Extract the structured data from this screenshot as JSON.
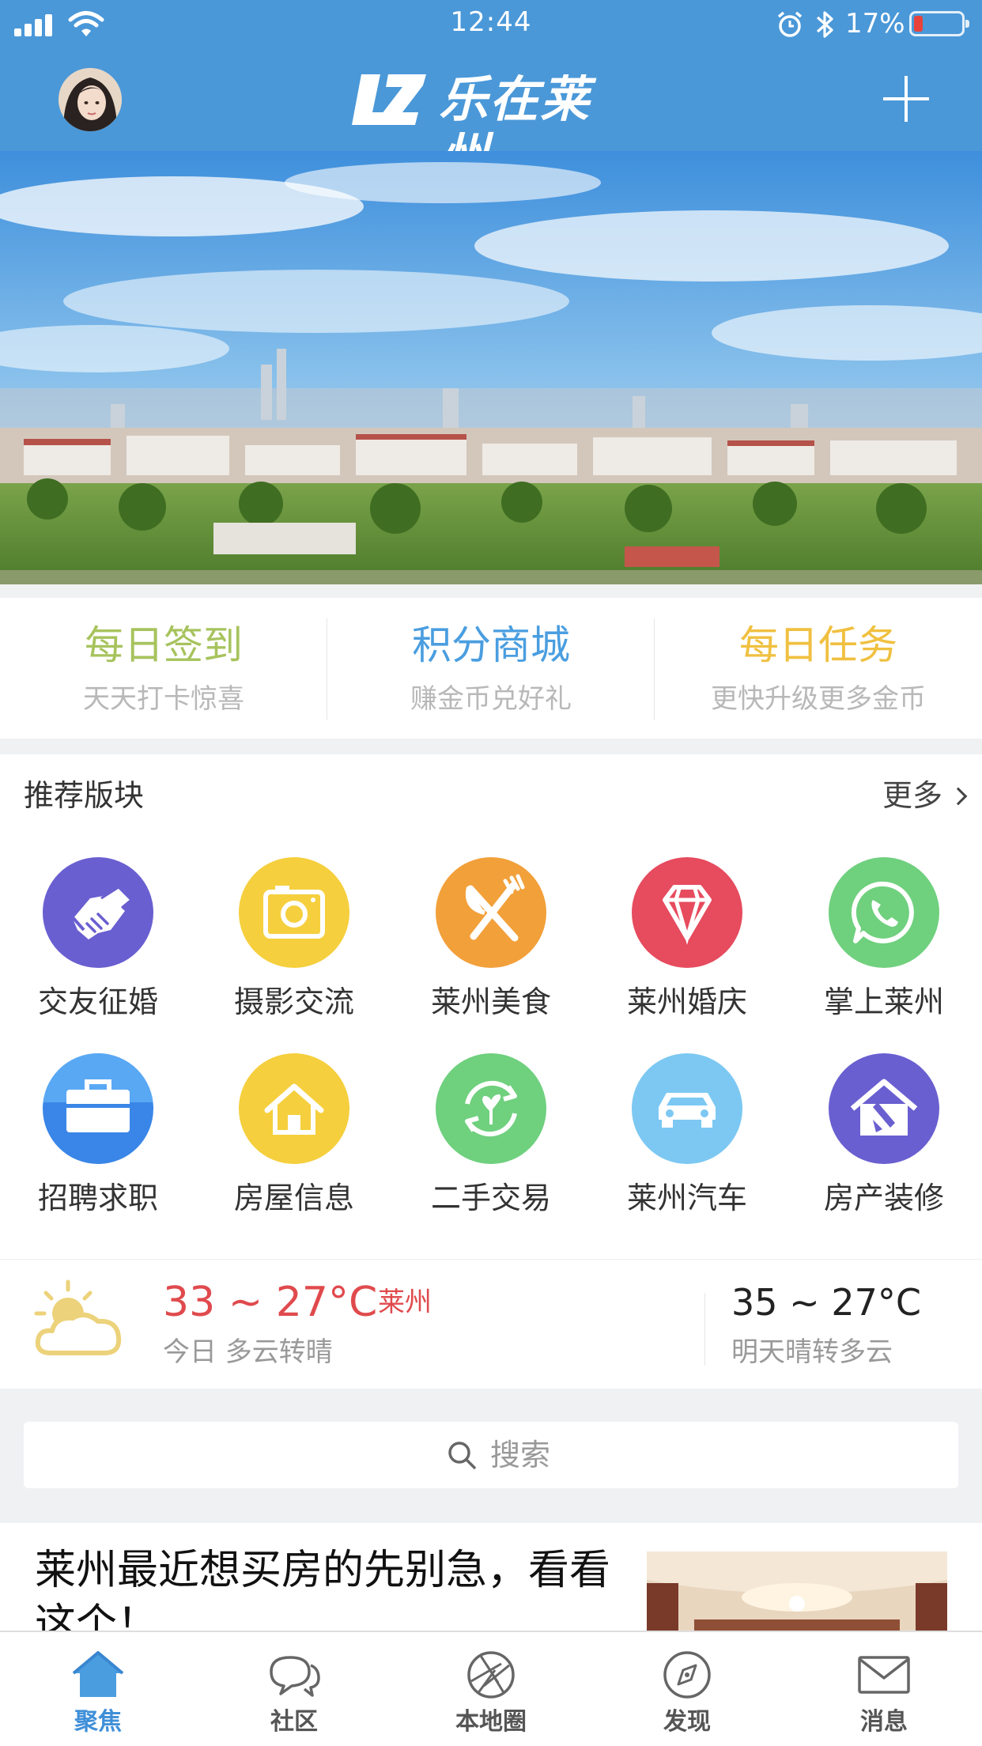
{
  "status_bar": {
    "time": "12:44",
    "battery": "17%"
  },
  "header": {
    "app_name": "乐在莱州",
    "logo_mark": "LZ",
    "add_icon": "plus-icon"
  },
  "quick_actions": [
    {
      "title": "每日签到",
      "subtitle": "天天打卡惊喜",
      "color": "#a7c35d"
    },
    {
      "title": "积分商城",
      "subtitle": "赚金币兑好礼",
      "color": "#4a9ee0"
    },
    {
      "title": "每日任务",
      "subtitle": "更快升级更多金币",
      "color": "#f0c040"
    }
  ],
  "recommended": {
    "title": "推荐版块",
    "more": "更多",
    "items": [
      {
        "label": "交友征婚",
        "icon": "handshake-icon",
        "color": "#6a5fd0"
      },
      {
        "label": "摄影交流",
        "icon": "camera-icon",
        "color": "#f5cf3d"
      },
      {
        "label": "莱州美食",
        "icon": "utensils-icon",
        "color": "#f2a03a"
      },
      {
        "label": "莱州婚庆",
        "icon": "diamond-icon",
        "color": "#e64b5e"
      },
      {
        "label": "掌上莱州",
        "icon": "phone-chat-icon",
        "color": "#6fd07e"
      },
      {
        "label": "招聘求职",
        "icon": "briefcase-icon",
        "color": "#3a86e8"
      },
      {
        "label": "房屋信息",
        "icon": "house-icon",
        "color": "#f5cf3d"
      },
      {
        "label": "二手交易",
        "icon": "recycle-icon",
        "color": "#6fd07e"
      },
      {
        "label": "莱州汽车",
        "icon": "car-icon",
        "color": "#7cc8f2"
      },
      {
        "label": "房产装修",
        "icon": "renovation-icon",
        "color": "#6a5fd0"
      }
    ]
  },
  "weather": {
    "today_temp": "33 ~ 27°C",
    "city": "莱州",
    "today_desc": "今日 多云转晴",
    "tomorrow_temp": "35 ~ 27°C",
    "tomorrow_desc": "明天晴转多云"
  },
  "search": {
    "placeholder": "搜索"
  },
  "article": {
    "title": "莱州最近想买房的先别急，看看这个！"
  },
  "tabs": [
    {
      "label": "聚焦",
      "icon": "home-icon",
      "active": true
    },
    {
      "label": "社区",
      "icon": "chat-bubbles-icon",
      "active": false
    },
    {
      "label": "本地圈",
      "icon": "aperture-icon",
      "active": false
    },
    {
      "label": "发现",
      "icon": "compass-icon",
      "active": false
    },
    {
      "label": "消息",
      "icon": "envelope-icon",
      "active": false
    }
  ]
}
